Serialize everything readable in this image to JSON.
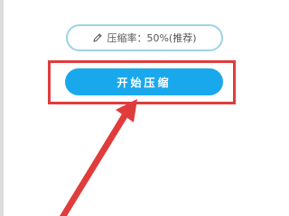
{
  "compression": {
    "label": "压缩率：50%(推荐)",
    "icon": "pencil-icon"
  },
  "start_button": {
    "label": "开始压缩"
  },
  "annotation": {
    "color": "#e03c3c"
  },
  "colors": {
    "button_bg": "#1aa8ec",
    "pill_border": "#9dd3e6"
  }
}
